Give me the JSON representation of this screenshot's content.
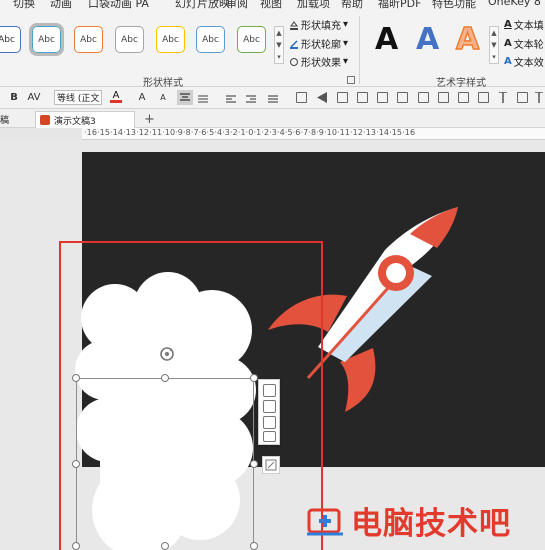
{
  "ribbon_tabs": [
    "切换",
    "动画",
    "口袋动画 PA",
    "幻灯片放映",
    "审阅",
    "视图",
    "加载项",
    "帮助",
    "福昕PDF",
    "特色功能",
    "OneKey 8"
  ],
  "shape_styles": {
    "gallery_label": "Abc",
    "group_label": "形状样式",
    "fill": "形状填充",
    "outline": "形状轮廓",
    "effects": "形状效果"
  },
  "wordart": {
    "group_label": "艺术字样式",
    "sample": "A",
    "text_fill": "文本填",
    "text_outline": "文本轮",
    "text_effects": "文本效"
  },
  "format_bar": {
    "bold": "B",
    "spacing": "AV",
    "font_name": "等线 (正文",
    "font_color_glyph": "A",
    "grow_font": "A",
    "shrink_font": "A"
  },
  "doc_tabs": {
    "partial_tab": "稿",
    "active_tab": "演示文稿3",
    "add_tab": "+"
  },
  "ruler_text": "·16·15·14·13·12·11·10·9·8·7·6·5·4·3·2·1·0·1·2·3·4·5·6·7·8·9·10·11·12·13·14·15·16",
  "watermark": {
    "text": "电脑技术吧"
  },
  "colors": {
    "ribbon_bg": "#f3f3f3",
    "slide_bg": "#262626",
    "selection_red": "#e0352b",
    "rocket_red": "#e2523c",
    "rocket_blue": "#cfe3f2",
    "wordart_blue": "#4472c4",
    "wordart_orange": "#ed7d31"
  },
  "icons": [
    "shape-fill-icon",
    "shape-outline-icon",
    "shape-effects-icon",
    "text-fill-icon",
    "text-outline-icon",
    "text-effects-icon",
    "rotate-handle-icon",
    "layout-options-icon",
    "powerpoint-file-icon"
  ]
}
